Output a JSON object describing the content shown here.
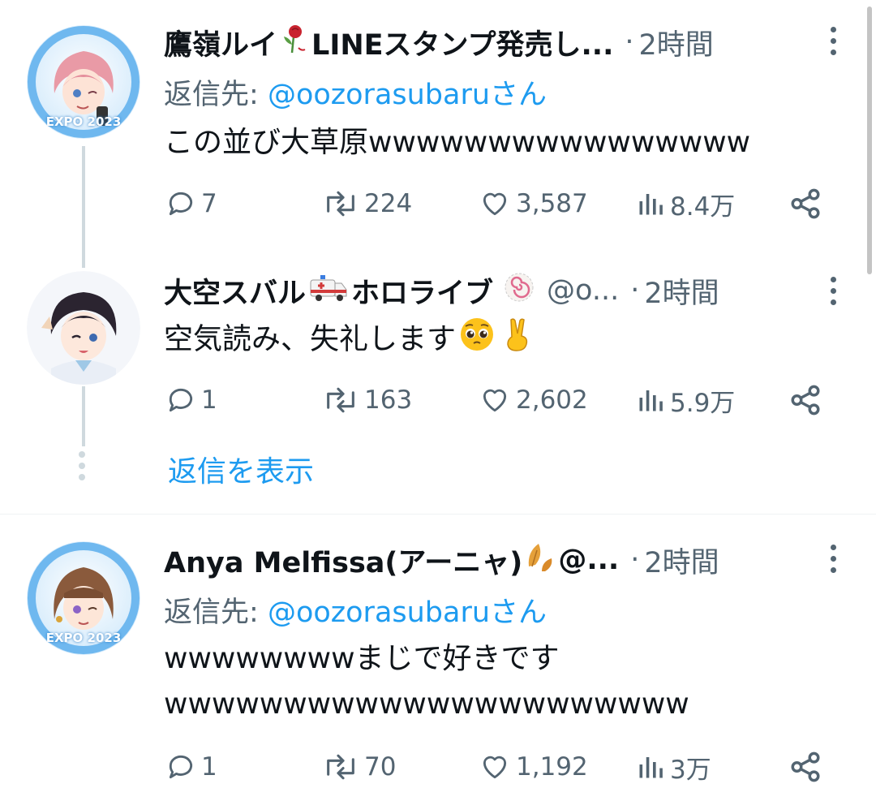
{
  "tweets": [
    {
      "name": "鷹嶺ルイ",
      "name_suffix": "LINEスタンプ発売し...",
      "time": "2時間",
      "reply_label": "返信先:",
      "reply_to": "@oozorasubaruさん",
      "text": "この並び大草原wwwwwwwwwwwwwwww",
      "replies": "7",
      "retweets": "224",
      "likes": "3,587",
      "views": "8.4万",
      "avatar_badge": "EXPO 2023"
    },
    {
      "name": "大空スバル",
      "name_suffix": "ホロライブ",
      "handle": "@o...",
      "time": "2時間",
      "text": "空気読み、失礼します",
      "replies": "1",
      "retweets": "163",
      "likes": "2,602",
      "views": "5.9万"
    },
    {
      "name": "Anya Melfissa(アーニャ)",
      "handle": "@...",
      "time": "2時間",
      "reply_label": "返信先:",
      "reply_to": "@oozorasubaruさん",
      "text_line1": "wwwwwwwwまじで好きです",
      "text_line2": "wwwwwwwwwwwwwwwwwwwwww",
      "replies": "1",
      "retweets": "70",
      "likes": "1,192",
      "views": "3万",
      "avatar_badge": "EXPO 2023"
    }
  ],
  "show_replies_label": "返信を表示",
  "colors": {
    "text": "#0f1419",
    "secondary": "#536471",
    "accent": "#1d9bf0",
    "thread_line": "#cfd9de"
  }
}
